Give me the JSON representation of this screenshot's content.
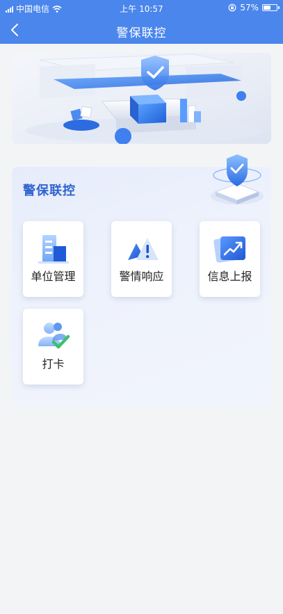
{
  "status_bar": {
    "carrier": "中国电信",
    "time": "上午 10:57",
    "battery_text": "57%",
    "battery_level": 0.57,
    "icons": [
      "signal-icon",
      "wifi-icon",
      "rotation-lock-icon",
      "battery-icon"
    ]
  },
  "nav": {
    "title": "警保联控",
    "back_icon": "chevron-left-icon"
  },
  "banner": {
    "image": "security-shield-3d-illustration"
  },
  "panel": {
    "title": "警保联控",
    "decoration": "shield-platform-icon",
    "items": [
      {
        "label": "单位管理",
        "icon": "buildings-icon"
      },
      {
        "label": "警情响应",
        "icon": "alert-icon"
      },
      {
        "label": "信息上报",
        "icon": "report-chart-icon"
      },
      {
        "label": "打卡",
        "icon": "user-check-icon"
      }
    ]
  },
  "colors": {
    "header": "#4a86ec",
    "accent": "#2f63cf",
    "background": "#f3f4f6",
    "check_green": "#3cc16a"
  }
}
